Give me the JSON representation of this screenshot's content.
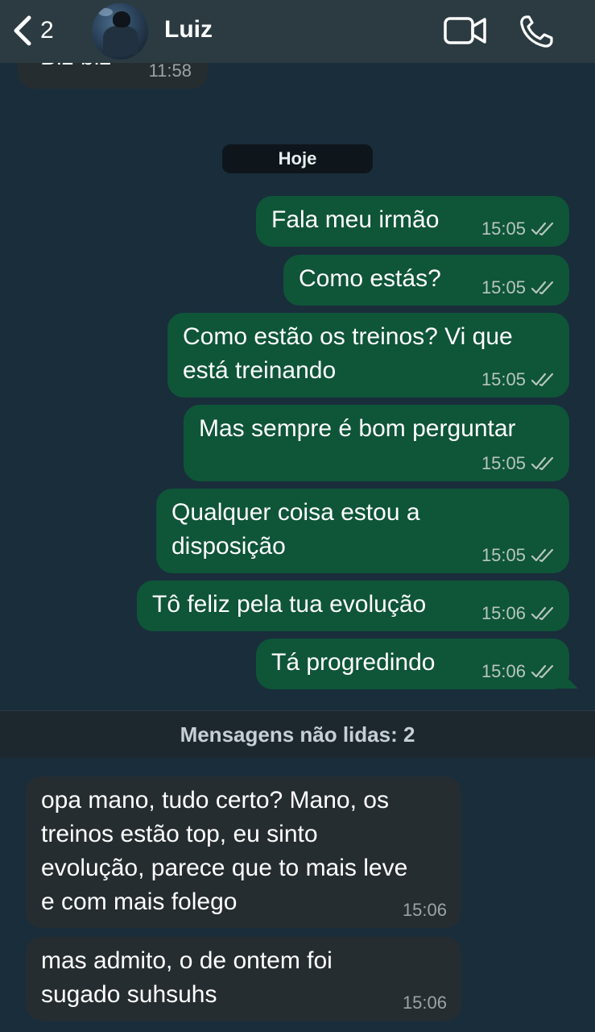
{
  "header": {
    "back_count": "2",
    "contact_name": "Luiz"
  },
  "top_partial": {
    "text": "Biz biz",
    "time": "11:58"
  },
  "day_label": "Hoje",
  "outgoing": [
    {
      "text": "Fala meu irmão",
      "time": "15:05"
    },
    {
      "text": "Como estás?",
      "time": "15:05"
    },
    {
      "text": "Como estão os treinos? Vi que\nestá treinando",
      "time": "15:05"
    },
    {
      "text": "Mas sempre é bom perguntar",
      "time": "15:05"
    },
    {
      "text": "Qualquer coisa estou a\ndisposição",
      "time": "15:05"
    },
    {
      "text": "Tô feliz pela tua evolução",
      "time": "15:06"
    },
    {
      "text": "Tá progredindo",
      "time": "15:06"
    }
  ],
  "unread_label": "Mensagens não lidas: 2",
  "incoming": [
    {
      "text": "opa mano, tudo certo? Mano, os\ntreinos estão top, eu sinto\nevolução, parece que to mais leve\ne com mais folego",
      "time": "15:06"
    },
    {
      "text": "mas admito, o de ontem foi\nsugado suhsuhs",
      "time": "15:06"
    }
  ],
  "colors": {
    "background": "#1a2d3b",
    "outgoing_bubble": "#0f5538",
    "incoming_bubble": "#262d31",
    "header": "#2b3b41"
  },
  "icons": [
    "chevron-left-icon",
    "video-call-icon",
    "phone-icon",
    "double-check-icon"
  ]
}
